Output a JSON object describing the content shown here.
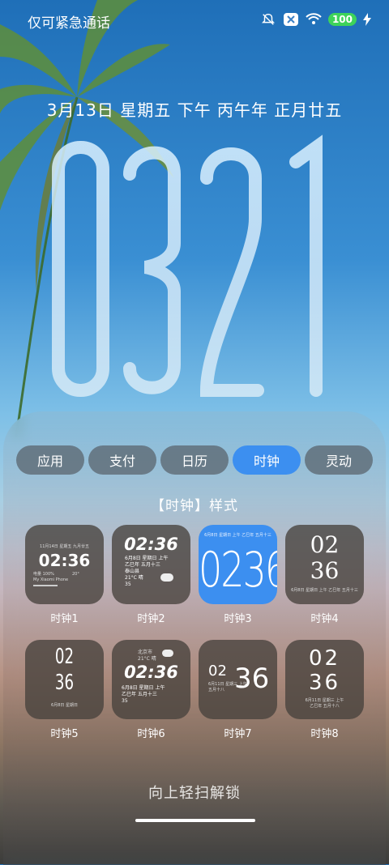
{
  "status_bar": {
    "carrier_text": "仅可紧急通话",
    "battery": "100",
    "icons": [
      "mute-icon",
      "close-badge-icon",
      "wifi-icon",
      "battery-icon",
      "charging-icon"
    ]
  },
  "lock_screen": {
    "date_text": "3月13日 星期五 下午 丙午年 正月廿五",
    "time_digits": "0321"
  },
  "tabs": [
    {
      "label": "应用",
      "active": false
    },
    {
      "label": "支付",
      "active": false
    },
    {
      "label": "日历",
      "active": false
    },
    {
      "label": "时钟",
      "active": true
    },
    {
      "label": "灵动",
      "active": false
    }
  ],
  "section_title": "【时钟】样式",
  "styles": [
    {
      "label": "时钟1",
      "time": "02:36",
      "meta": "11月14日 星期五 九月廿五",
      "sub": [
        "电量 100%",
        "My Xiaomi Phone"
      ],
      "weather": "20°"
    },
    {
      "label": "时钟2",
      "time": "02:36",
      "lines": [
        "6月8日 星期日 上午",
        "乙巳年 五月十三",
        "泰山县",
        "21°C 晴",
        "35"
      ]
    },
    {
      "label": "时钟3",
      "time": "0236",
      "meta": "6月8日 星期日 上午 乙巳年 五月十三"
    },
    {
      "label": "时钟4",
      "time_top": "02",
      "time_bottom": "36",
      "meta": "6月8日 星期日 上午 乙巳年 五月十三"
    },
    {
      "label": "时钟5",
      "time_top": "02",
      "time_bottom": "36",
      "meta": "6月8日 星期日"
    },
    {
      "label": "时钟6",
      "time": "02:36",
      "lines": [
        "北京市",
        "21°C 晴",
        "6月8日 星期日 上午",
        "乙巳年 五月十三",
        "35"
      ]
    },
    {
      "label": "时钟7",
      "time_left": "02",
      "time_right": "36",
      "meta": [
        "6月11日 星期三 上午",
        "五月十八"
      ]
    },
    {
      "label": "时钟8",
      "time_top": "02",
      "time_bottom": "36",
      "meta": [
        "6月11日 星期三 上午",
        "乙巳年 五月十八"
      ]
    }
  ],
  "unlock_hint": "向上轻扫解锁"
}
